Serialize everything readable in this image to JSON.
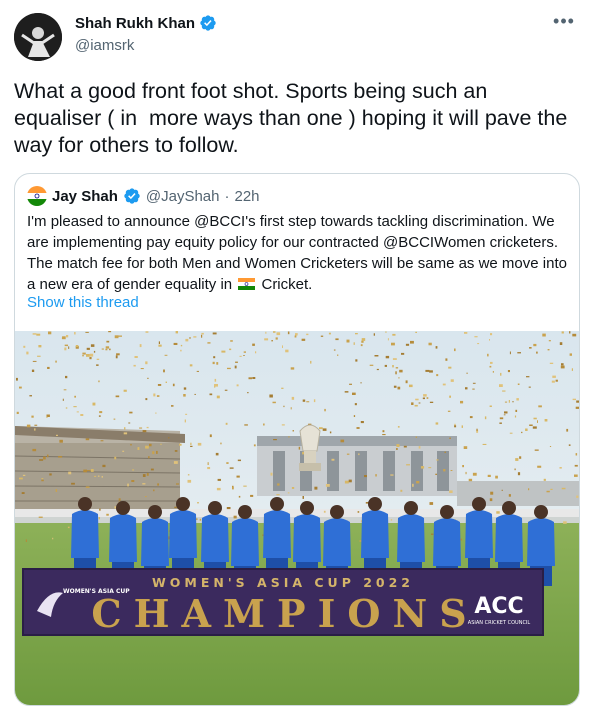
{
  "author": {
    "display_name": "Shah Rukh Khan",
    "handle": "@iamsrk",
    "verified": true
  },
  "more_icon": "more-horizontal-icon",
  "tweet_text": "What a good front foot shot. Sports being such an equaliser ( in  more ways than one ) hoping it will pave the way for others to follow.",
  "quoted": {
    "display_name": "Jay Shah",
    "handle": "@JayShah",
    "separator": "·",
    "time": "22h",
    "text_before_flag": "I'm pleased to announce @BCCI's first step towards tackling discrimination. We are implementing pay equity policy for our contracted @BCCIWomen cricketers. The match fee for both Men and Women Cricketers will be same as we move into a new era of gender equality in",
    "text_after_flag": "Cricket.",
    "show_thread_label": "Show this thread",
    "photo": {
      "banner_top": "WOMEN'S ASIA CUP 2022",
      "banner_main": "CHAMPIONS",
      "logo_left": "WOMEN'S ASIA CUP",
      "logo_right": "ACC",
      "logo_right_sub": "ASIAN CRICKET COUNCIL"
    }
  },
  "colors": {
    "link": "#1d9bf0",
    "secondary_text": "#536471",
    "border": "#cfd9de",
    "banner": "#3b2a5e",
    "jersey": "#2f6fd6"
  }
}
